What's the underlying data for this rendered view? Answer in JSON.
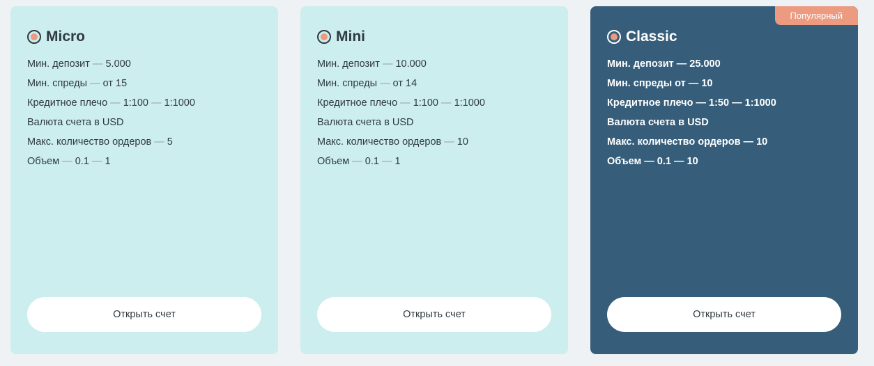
{
  "cards": [
    {
      "title": "Micro",
      "features": [
        [
          "Мин. депозит",
          "—",
          "5.000"
        ],
        [
          "Мин. спреды",
          "—",
          "от 15"
        ],
        [
          "Кредитное плечо",
          "—",
          "1:100",
          "—",
          "1:1000"
        ],
        [
          "Валюта счета в USD"
        ],
        [
          "Макс. количество ордеров",
          "—",
          "5"
        ],
        [
          "Объем",
          "—",
          "0.1",
          "—",
          "1"
        ]
      ],
      "button_label": "Открыть счет"
    },
    {
      "title": "Mini",
      "features": [
        [
          "Мин. депозит",
          "—",
          "10.000"
        ],
        [
          "Мин. спреды",
          "—",
          "от 14"
        ],
        [
          "Кредитное плечо",
          "—",
          "1:100",
          "—",
          "1:1000"
        ],
        [
          "Валюта счета в USD"
        ],
        [
          "Макс. количество ордеров",
          "—",
          "10"
        ],
        [
          "Объем",
          "—",
          "0.1",
          "—",
          "1"
        ]
      ],
      "button_label": "Открыть счет"
    },
    {
      "title": "Classic",
      "badge": "Популярный",
      "features": [
        [
          "Мин. депозит",
          "—",
          "25.000"
        ],
        [
          "Мин. спреды от",
          "—",
          "10"
        ],
        [
          "Кредитное плечо",
          "—",
          "1:50",
          "—",
          "1:1000"
        ],
        [
          "Валюта счета в USD"
        ],
        [
          "Макс. количество ордеров",
          "—",
          "10"
        ],
        [
          "Объем",
          "—",
          "0.1",
          "—",
          "10"
        ]
      ],
      "button_label": "Открыть счет"
    }
  ],
  "colors": {
    "page_bg": "#eef2f4",
    "card_light_bg": "#cdeeee",
    "card_dark_bg": "#365e7a",
    "accent": "#ec9a80",
    "text_dark": "#2f3a41",
    "separator_light": "#8aa0a8"
  },
  "icons": {
    "plan_radio": "radio-selected-icon"
  }
}
